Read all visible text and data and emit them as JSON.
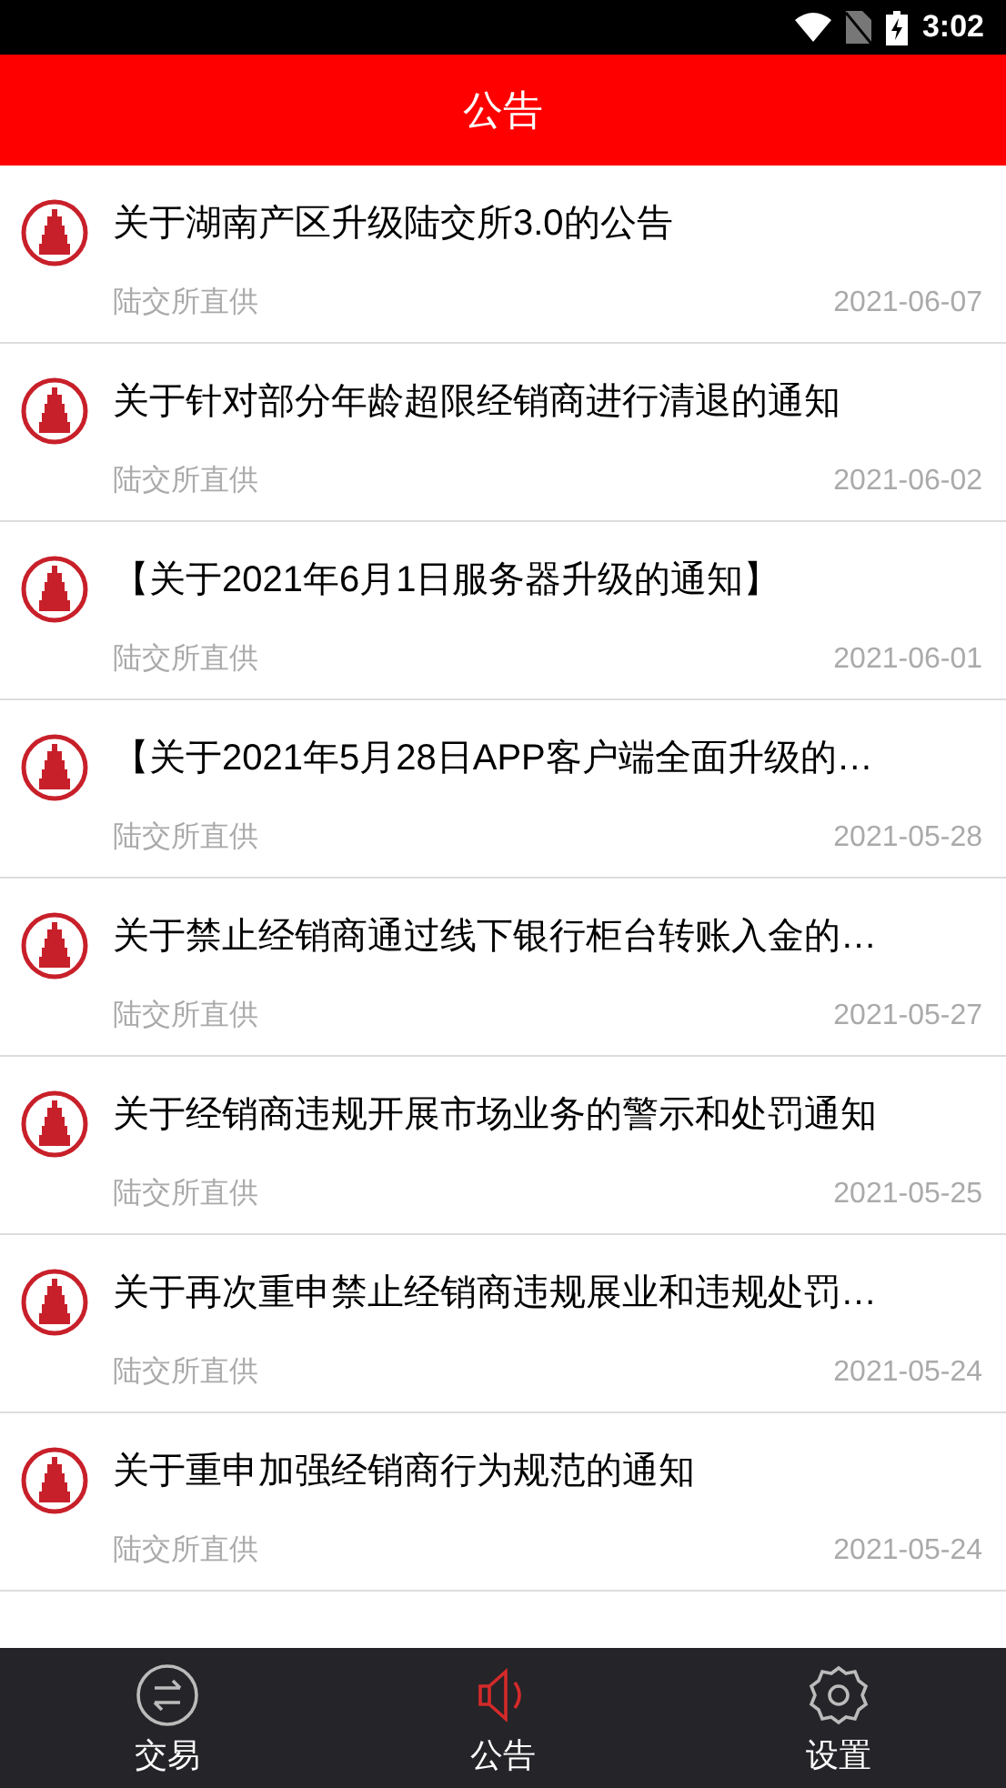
{
  "status_bar": {
    "time": "3:02"
  },
  "header": {
    "title": "公告"
  },
  "notices": [
    {
      "title": "关于湖南产区升级陆交所3.0的公告",
      "source": "陆交所直供",
      "date": "2021-06-07"
    },
    {
      "title": "关于针对部分年龄超限经销商进行清退的通知",
      "source": "陆交所直供",
      "date": "2021-06-02"
    },
    {
      "title": "【关于2021年6月1日服务器升级的通知】",
      "source": "陆交所直供",
      "date": "2021-06-01"
    },
    {
      "title": "【关于2021年5月28日APP客户端全面升级的…",
      "source": "陆交所直供",
      "date": "2021-05-28"
    },
    {
      "title": "关于禁止经销商通过线下银行柜台转账入金的…",
      "source": "陆交所直供",
      "date": "2021-05-27"
    },
    {
      "title": "关于经销商违规开展市场业务的警示和处罚通知",
      "source": "陆交所直供",
      "date": "2021-05-25"
    },
    {
      "title": "关于再次重申禁止经销商违规展业和违规处罚…",
      "source": "陆交所直供",
      "date": "2021-05-24"
    },
    {
      "title": "关于重申加强经销商行为规范的通知",
      "source": "陆交所直供",
      "date": "2021-05-24"
    }
  ],
  "bottom_nav": [
    {
      "label": "交易",
      "kind": "exchange",
      "selected": false
    },
    {
      "label": "公告",
      "kind": "speaker",
      "selected": true
    },
    {
      "label": "设置",
      "kind": "settings",
      "selected": false
    }
  ]
}
